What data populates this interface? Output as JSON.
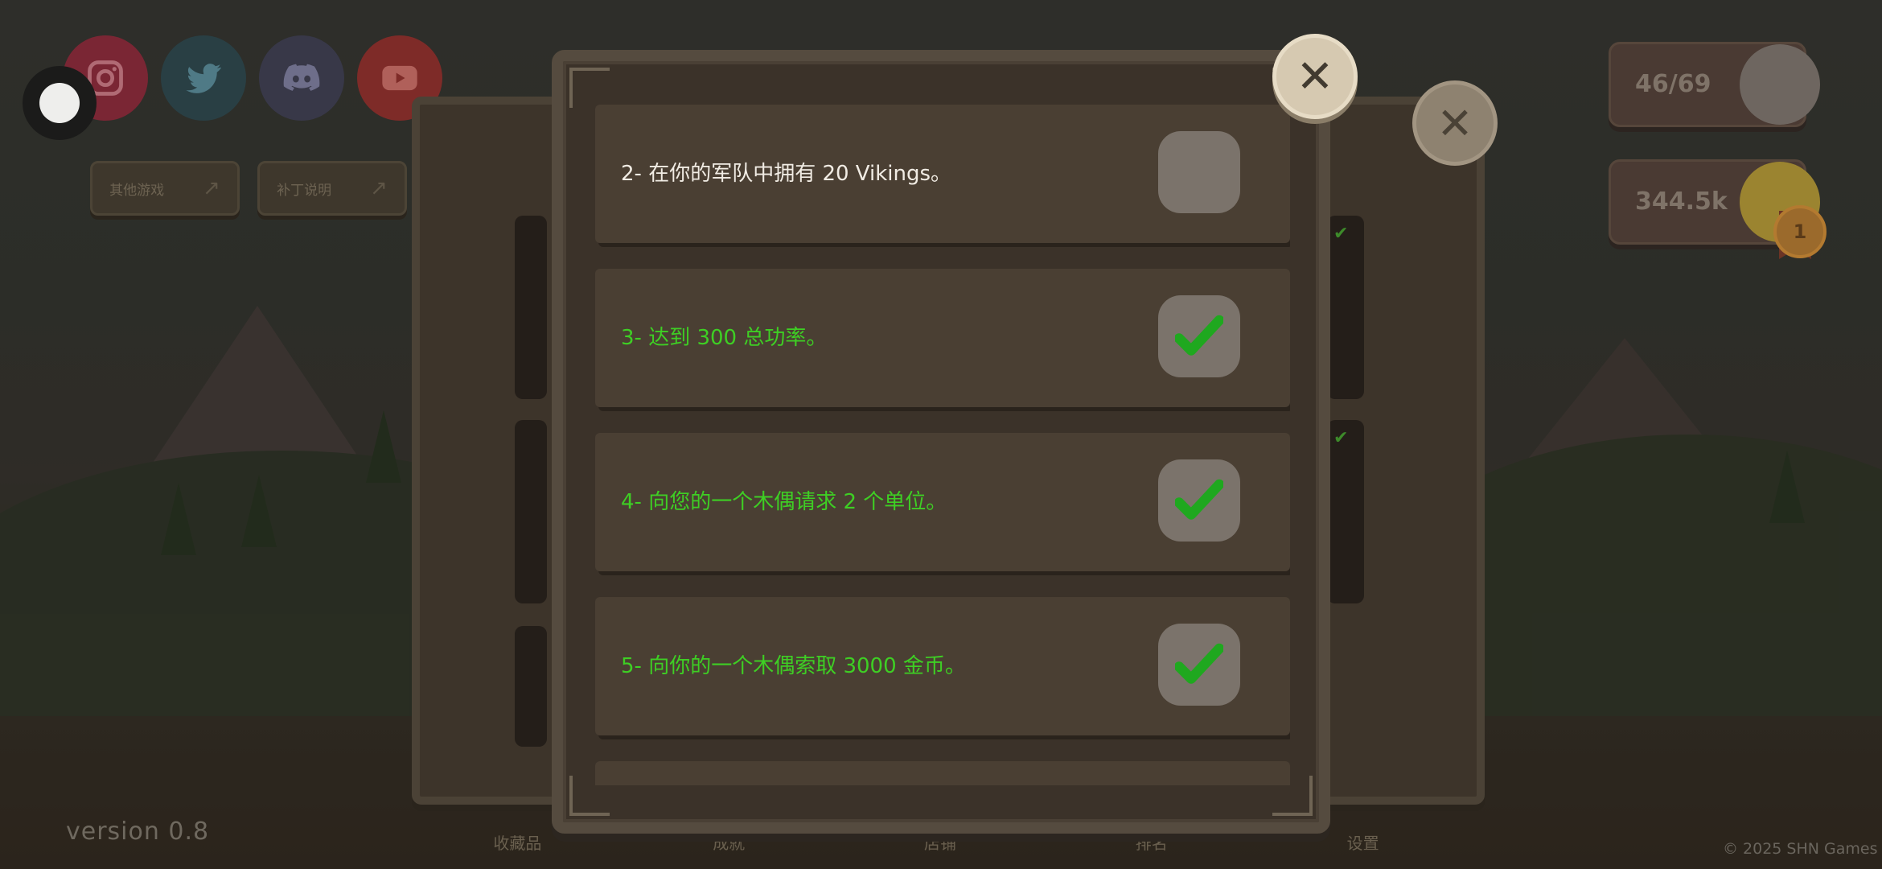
{
  "background": {
    "social_icons": [
      {
        "name": "instagram-icon",
        "color": "#8e2a3a"
      },
      {
        "name": "twitter-icon",
        "color": "#2a4148"
      },
      {
        "name": "discord-icon",
        "color": "#3a3a4a"
      },
      {
        "name": "youtube-icon",
        "color": "#8a2f2c"
      }
    ],
    "links": [
      {
        "label": "其他游戏",
        "icon": "external-link-icon"
      },
      {
        "label": "补丁说明",
        "icon": "external-link-icon"
      }
    ],
    "stats": {
      "army": "46/69",
      "power": "344.5k",
      "rank": "1"
    },
    "nav": [
      "收藏品",
      "成就",
      "店铺",
      "排名",
      "设置"
    ],
    "version": "version 0.8",
    "copyright": "© 2025 SHN Games"
  },
  "achievements": {
    "close_icon": "close-icon",
    "items": [
      {
        "text": "2- 在你的军队中拥有 20 Vikings。",
        "completed": false
      },
      {
        "text": "3- 达到 300 总功率。",
        "completed": true
      },
      {
        "text": "4- 向您的一个木偶请求 2 个单位。",
        "completed": true
      },
      {
        "text": "5- 向你的一个木偶索取 3000 金币。",
        "completed": true
      }
    ]
  },
  "colors": {
    "completed_text": "#3ecf24",
    "pending_text": "#f1ece4",
    "check": "#1fa81f"
  }
}
